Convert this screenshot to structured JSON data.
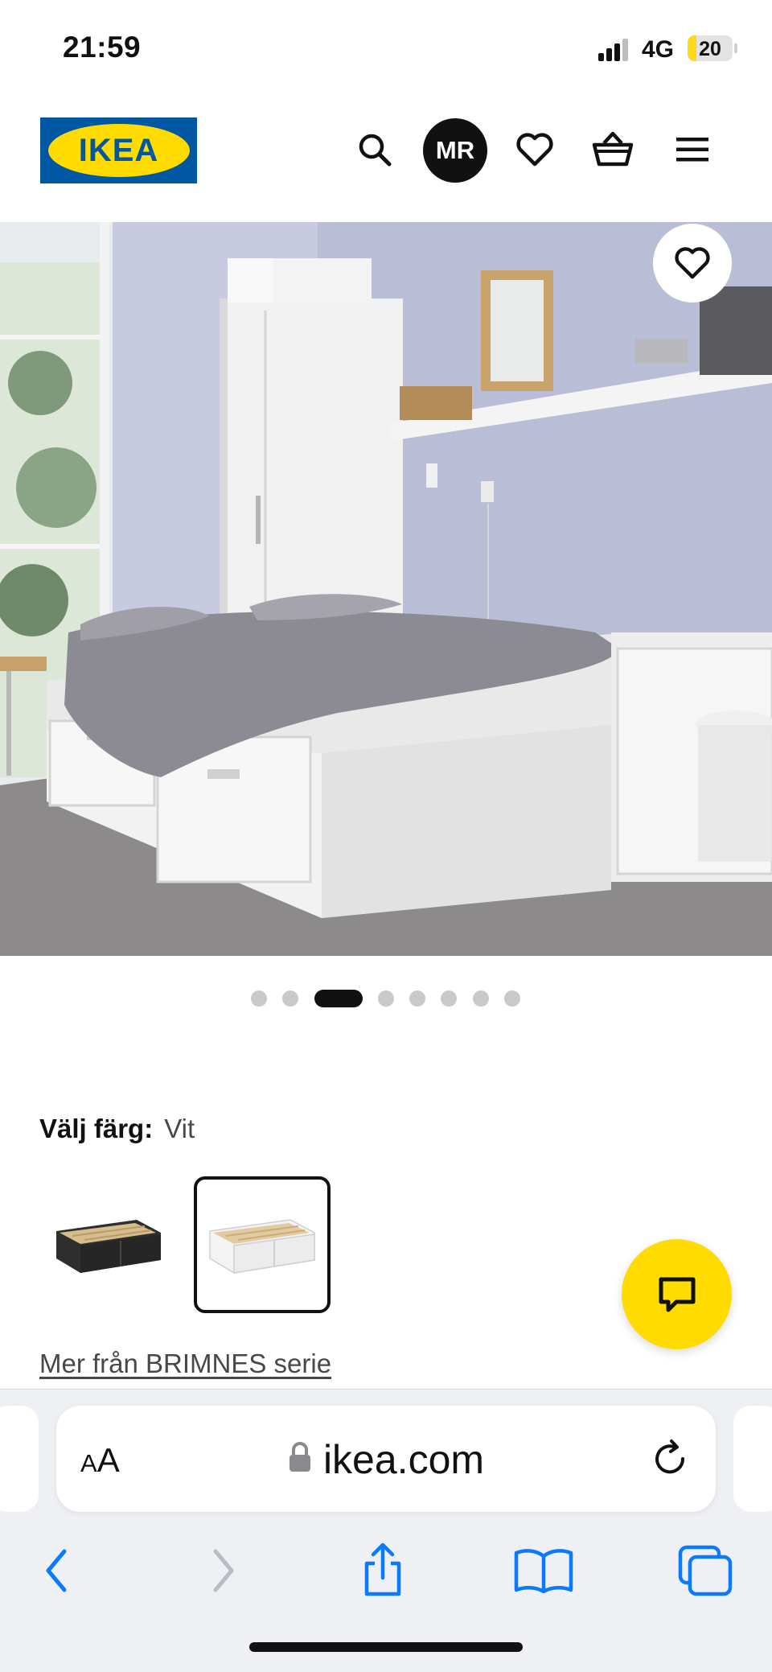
{
  "status_bar": {
    "time": "21:59",
    "network": "4G",
    "battery_percent": "20",
    "signal_bars_active": 3,
    "signal_bars_total": 4
  },
  "header": {
    "logo_text": "IKEA",
    "avatar_initials": "MR",
    "icons": [
      "search-icon",
      "heart-icon",
      "shopping-basket-icon",
      "menu-icon"
    ]
  },
  "gallery": {
    "image_count": 8,
    "active_index": 2,
    "favourite_icon": "heart-icon"
  },
  "color_selection": {
    "label": "Välj färg:",
    "selected_value": "Vit",
    "options": [
      {
        "name": "black-brown",
        "frame_color": "#2e2e2e",
        "selected": false
      },
      {
        "name": "white",
        "frame_color": "#f3f3f3",
        "selected": true
      }
    ]
  },
  "series_link": "Mer från BRIMNES serie",
  "chat_button": {
    "icon": "chat-bubble-icon",
    "color": "#ffdb00"
  },
  "browser": {
    "text_size_button": "AA",
    "url": "ikea.com",
    "toolbar_icons": [
      "back-icon",
      "forward-icon",
      "share-icon",
      "bookmarks-icon",
      "tabs-icon"
    ]
  },
  "colors": {
    "brand_blue": "#0058a3",
    "brand_yellow": "#ffdb00",
    "safari_blue": "#0a7aff"
  }
}
